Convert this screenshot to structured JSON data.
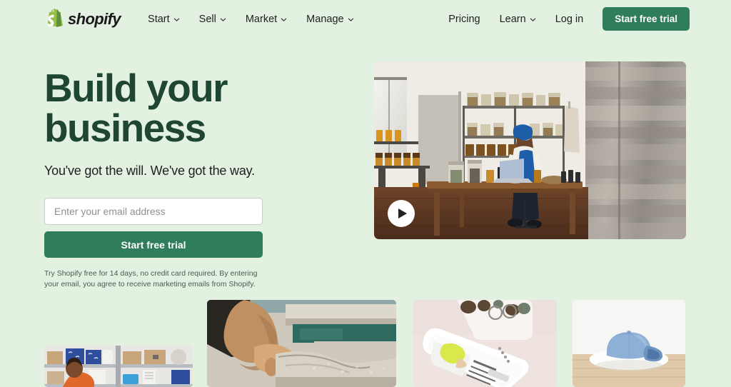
{
  "brand": {
    "name": "shopify",
    "logo_icon": "shopify-bag-icon",
    "green": "#2f7d5b",
    "logo_green": "#95bf47",
    "headline_green": "#1e4632",
    "background": "#e3f1e1"
  },
  "nav": {
    "left_items": [
      {
        "label": "Start",
        "has_chevron": true
      },
      {
        "label": "Sell",
        "has_chevron": true
      },
      {
        "label": "Market",
        "has_chevron": true
      },
      {
        "label": "Manage",
        "has_chevron": true
      }
    ],
    "right_items": [
      {
        "label": "Pricing",
        "has_chevron": false
      },
      {
        "label": "Learn",
        "has_chevron": true
      },
      {
        "label": "Log in",
        "has_chevron": false
      }
    ],
    "cta_label": "Start free trial"
  },
  "hero": {
    "headline_line1": "Build your",
    "headline_line2": "business",
    "subheading": "You've got the will. We've got the way.",
    "email_placeholder": "Enter your email address",
    "email_value": "",
    "cta_label": "Start free trial",
    "fineprint": "Try Shopify free for 14 days, no credit card required. By entering your email, you agree to receive marketing emails from Shopify."
  },
  "video": {
    "name": "hero-video-thumbnail",
    "alt": "Woman in blue headwrap working on a laptop at a wooden table in a workshop with shelves of jars",
    "play_icon": "play-icon"
  },
  "gallery": [
    {
      "name": "gallery-image-warehouse",
      "alt": "Person in orange shirt standing in front of warehouse shelving with boxes"
    },
    {
      "name": "gallery-image-woodworking",
      "alt": "Hands sanding a wooden surface on a workbench"
    },
    {
      "name": "gallery-image-phone-store",
      "alt": "Smartphone showing an online store product page on a light surface"
    },
    {
      "name": "gallery-image-blue-cap",
      "alt": "Blue denim baseball cap displayed on a white disc on a wooden shelf"
    }
  ]
}
